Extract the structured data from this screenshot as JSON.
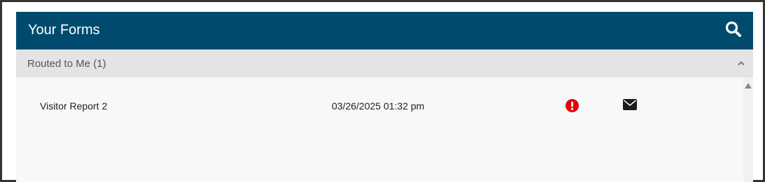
{
  "header": {
    "title": "Your Forms",
    "icon": "search-icon"
  },
  "section": {
    "title": "Routed to Me (1)",
    "collapse_icon": "chevron-up-icon"
  },
  "forms": [
    {
      "name": "Visitor Report 2",
      "date": "03/26/2025 01:32 pm",
      "status_icon": "alert-icon",
      "action_icon": "envelope-icon"
    }
  ],
  "colors": {
    "header_bg": "#004a6e",
    "section_bg": "#e3e4e6",
    "list_bg": "#f7f8fa",
    "alert": "#e8000b"
  }
}
